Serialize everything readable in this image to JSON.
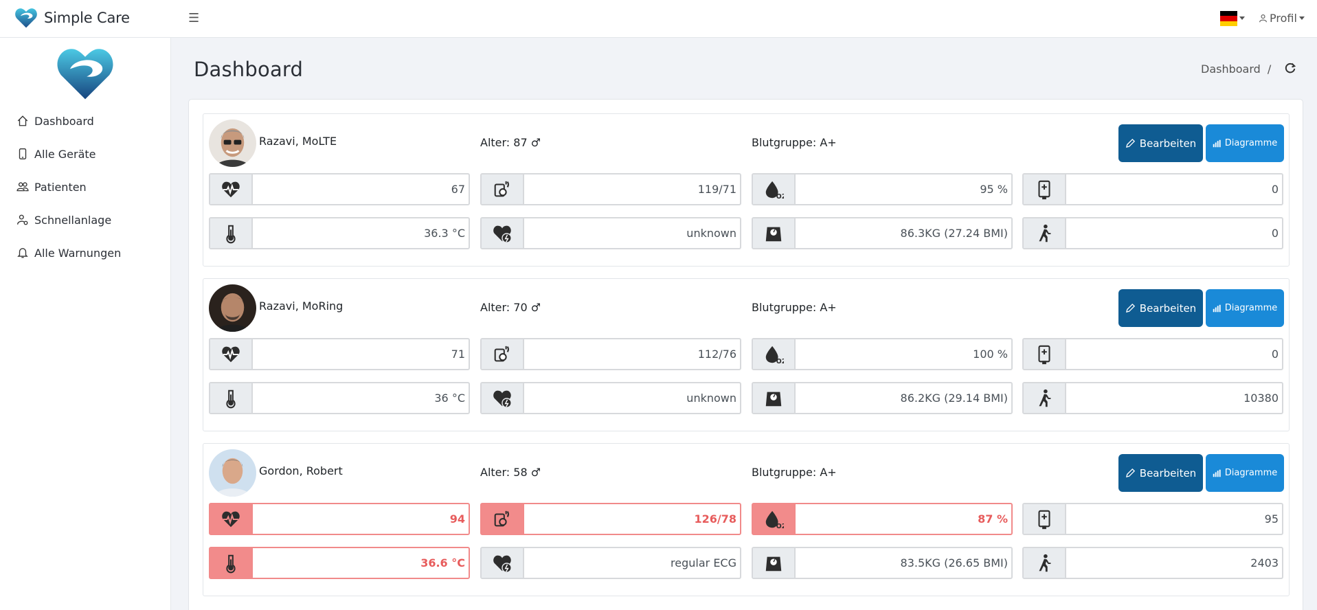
{
  "brand": {
    "name": "Simple Care"
  },
  "topbar": {
    "profile_label": "Profil"
  },
  "sidebar": {
    "items": [
      {
        "label": "Dashboard",
        "icon": "home-icon"
      },
      {
        "label": "Alle Geräte",
        "icon": "phone-icon"
      },
      {
        "label": "Patienten",
        "icon": "users-icon"
      },
      {
        "label": "Schnellanlage",
        "icon": "user-settings-icon"
      },
      {
        "label": "Alle Warnungen",
        "icon": "bell-icon"
      }
    ]
  },
  "header": {
    "title": "Dashboard",
    "breadcrumb": "Dashboard",
    "breadcrumb_sep": "/"
  },
  "colors": {
    "primary": "#0f5c92",
    "secondary": "#1a8ad8",
    "alert": "#f28b8b",
    "alert_text": "#e75c5c"
  },
  "buttons": {
    "edit_label": "Bearbeiten",
    "charts_label": "Diagramme"
  },
  "patients": [
    {
      "name": "Razavi, MoLTE",
      "age": "Alter: 87 ♂",
      "blood": "Blutgruppe: A+",
      "heart_rate": "67",
      "blood_pressure": "119/71",
      "spo2": "95 %",
      "device": "0",
      "temperature": "36.3 °C",
      "ecg": "unknown",
      "weight": "86.3KG (27.24 BMI)",
      "steps": "0",
      "alerts": {
        "heart_rate": false,
        "blood_pressure": false,
        "spo2": false,
        "temperature": false
      }
    },
    {
      "name": "Razavi, MoRing",
      "age": "Alter: 70 ♂",
      "blood": "Blutgruppe: A+",
      "heart_rate": "71",
      "blood_pressure": "112/76",
      "spo2": "100 %",
      "device": "0",
      "temperature": "36 °C",
      "ecg": "unknown",
      "weight": "86.2KG (29.14 BMI)",
      "steps": "10380",
      "alerts": {
        "heart_rate": false,
        "blood_pressure": false,
        "spo2": false,
        "temperature": false
      }
    },
    {
      "name": "Gordon, Robert",
      "age": "Alter: 58 ♂",
      "blood": "Blutgruppe: A+",
      "heart_rate": "94",
      "blood_pressure": "126/78",
      "spo2": "87 %",
      "device": "95",
      "temperature": "36.6 °C",
      "ecg": "regular ECG",
      "weight": "83.5KG (26.65 BMI)",
      "steps": "2403",
      "alerts": {
        "heart_rate": true,
        "blood_pressure": true,
        "spo2": true,
        "temperature": true
      }
    }
  ]
}
